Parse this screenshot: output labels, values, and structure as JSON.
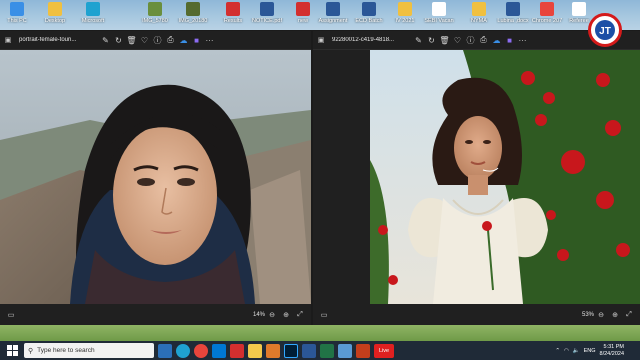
{
  "desktop": {
    "icons": [
      {
        "label": "This PC",
        "icon": "pc-icon",
        "color": "#3a8fe6"
      },
      {
        "label": "Desktop",
        "icon": "folder-icon",
        "color": "#f0c040"
      },
      {
        "label": "Microsoft",
        "icon": "edge-icon",
        "color": "#1fa2d0"
      },
      {
        "label": "IMG_5780",
        "icon": "image-file-icon",
        "color": "#6a8f3d"
      },
      {
        "label": "IMG_20180",
        "icon": "image-file-icon",
        "color": "#556b2f"
      },
      {
        "label": "Results",
        "icon": "pdf-icon",
        "color": "#d32f2f"
      },
      {
        "label": "NOTICE.pdf",
        "icon": "word-doc-icon",
        "color": "#2b5797"
      },
      {
        "label": "new",
        "icon": "pdf-icon",
        "color": "#d32f2f"
      },
      {
        "label": "Assignment",
        "icon": "word-doc-icon",
        "color": "#2b5797"
      },
      {
        "label": "ECD Batch",
        "icon": "word-doc-icon",
        "color": "#2b5797"
      },
      {
        "label": "IV 2021",
        "icon": "folder-icon",
        "color": "#f0c040"
      },
      {
        "label": "SEBI Vacan",
        "icon": "document-icon",
        "color": "#ffffff"
      },
      {
        "label": "NYMA",
        "icon": "folder-icon",
        "color": "#f0c040"
      },
      {
        "label": "Lubina ,docx",
        "icon": "word-doc-icon",
        "color": "#2b5797"
      },
      {
        "label": "Chrome 207",
        "icon": "chrome-icon",
        "color": "#e8453c"
      },
      {
        "label": "Referee",
        "icon": "document-icon",
        "color": "#ffffff"
      }
    ]
  },
  "viewers": {
    "left": {
      "filename": "portrait-female-touri...",
      "zoom": "14%"
    },
    "right": {
      "filename": "92280012-c419-4818...",
      "zoom": "53%"
    }
  },
  "toolbar_icons": [
    "edit-icon",
    "rotate-icon",
    "delete-icon",
    "favorite-icon",
    "info-icon",
    "print-icon",
    "cloud-icon",
    "editor-app-icon",
    "more-icon"
  ],
  "taskbar": {
    "search_placeholder": "Type here to search",
    "live_label": "Live",
    "language": "ENG",
    "time": "5:31 PM",
    "date": "8/24/2024"
  },
  "colors": {
    "viewer_bg": "#202020",
    "taskbar_bg": "#1f2a37",
    "accent_red": "#d41a1a",
    "accent_blue": "#1d4fa6"
  }
}
